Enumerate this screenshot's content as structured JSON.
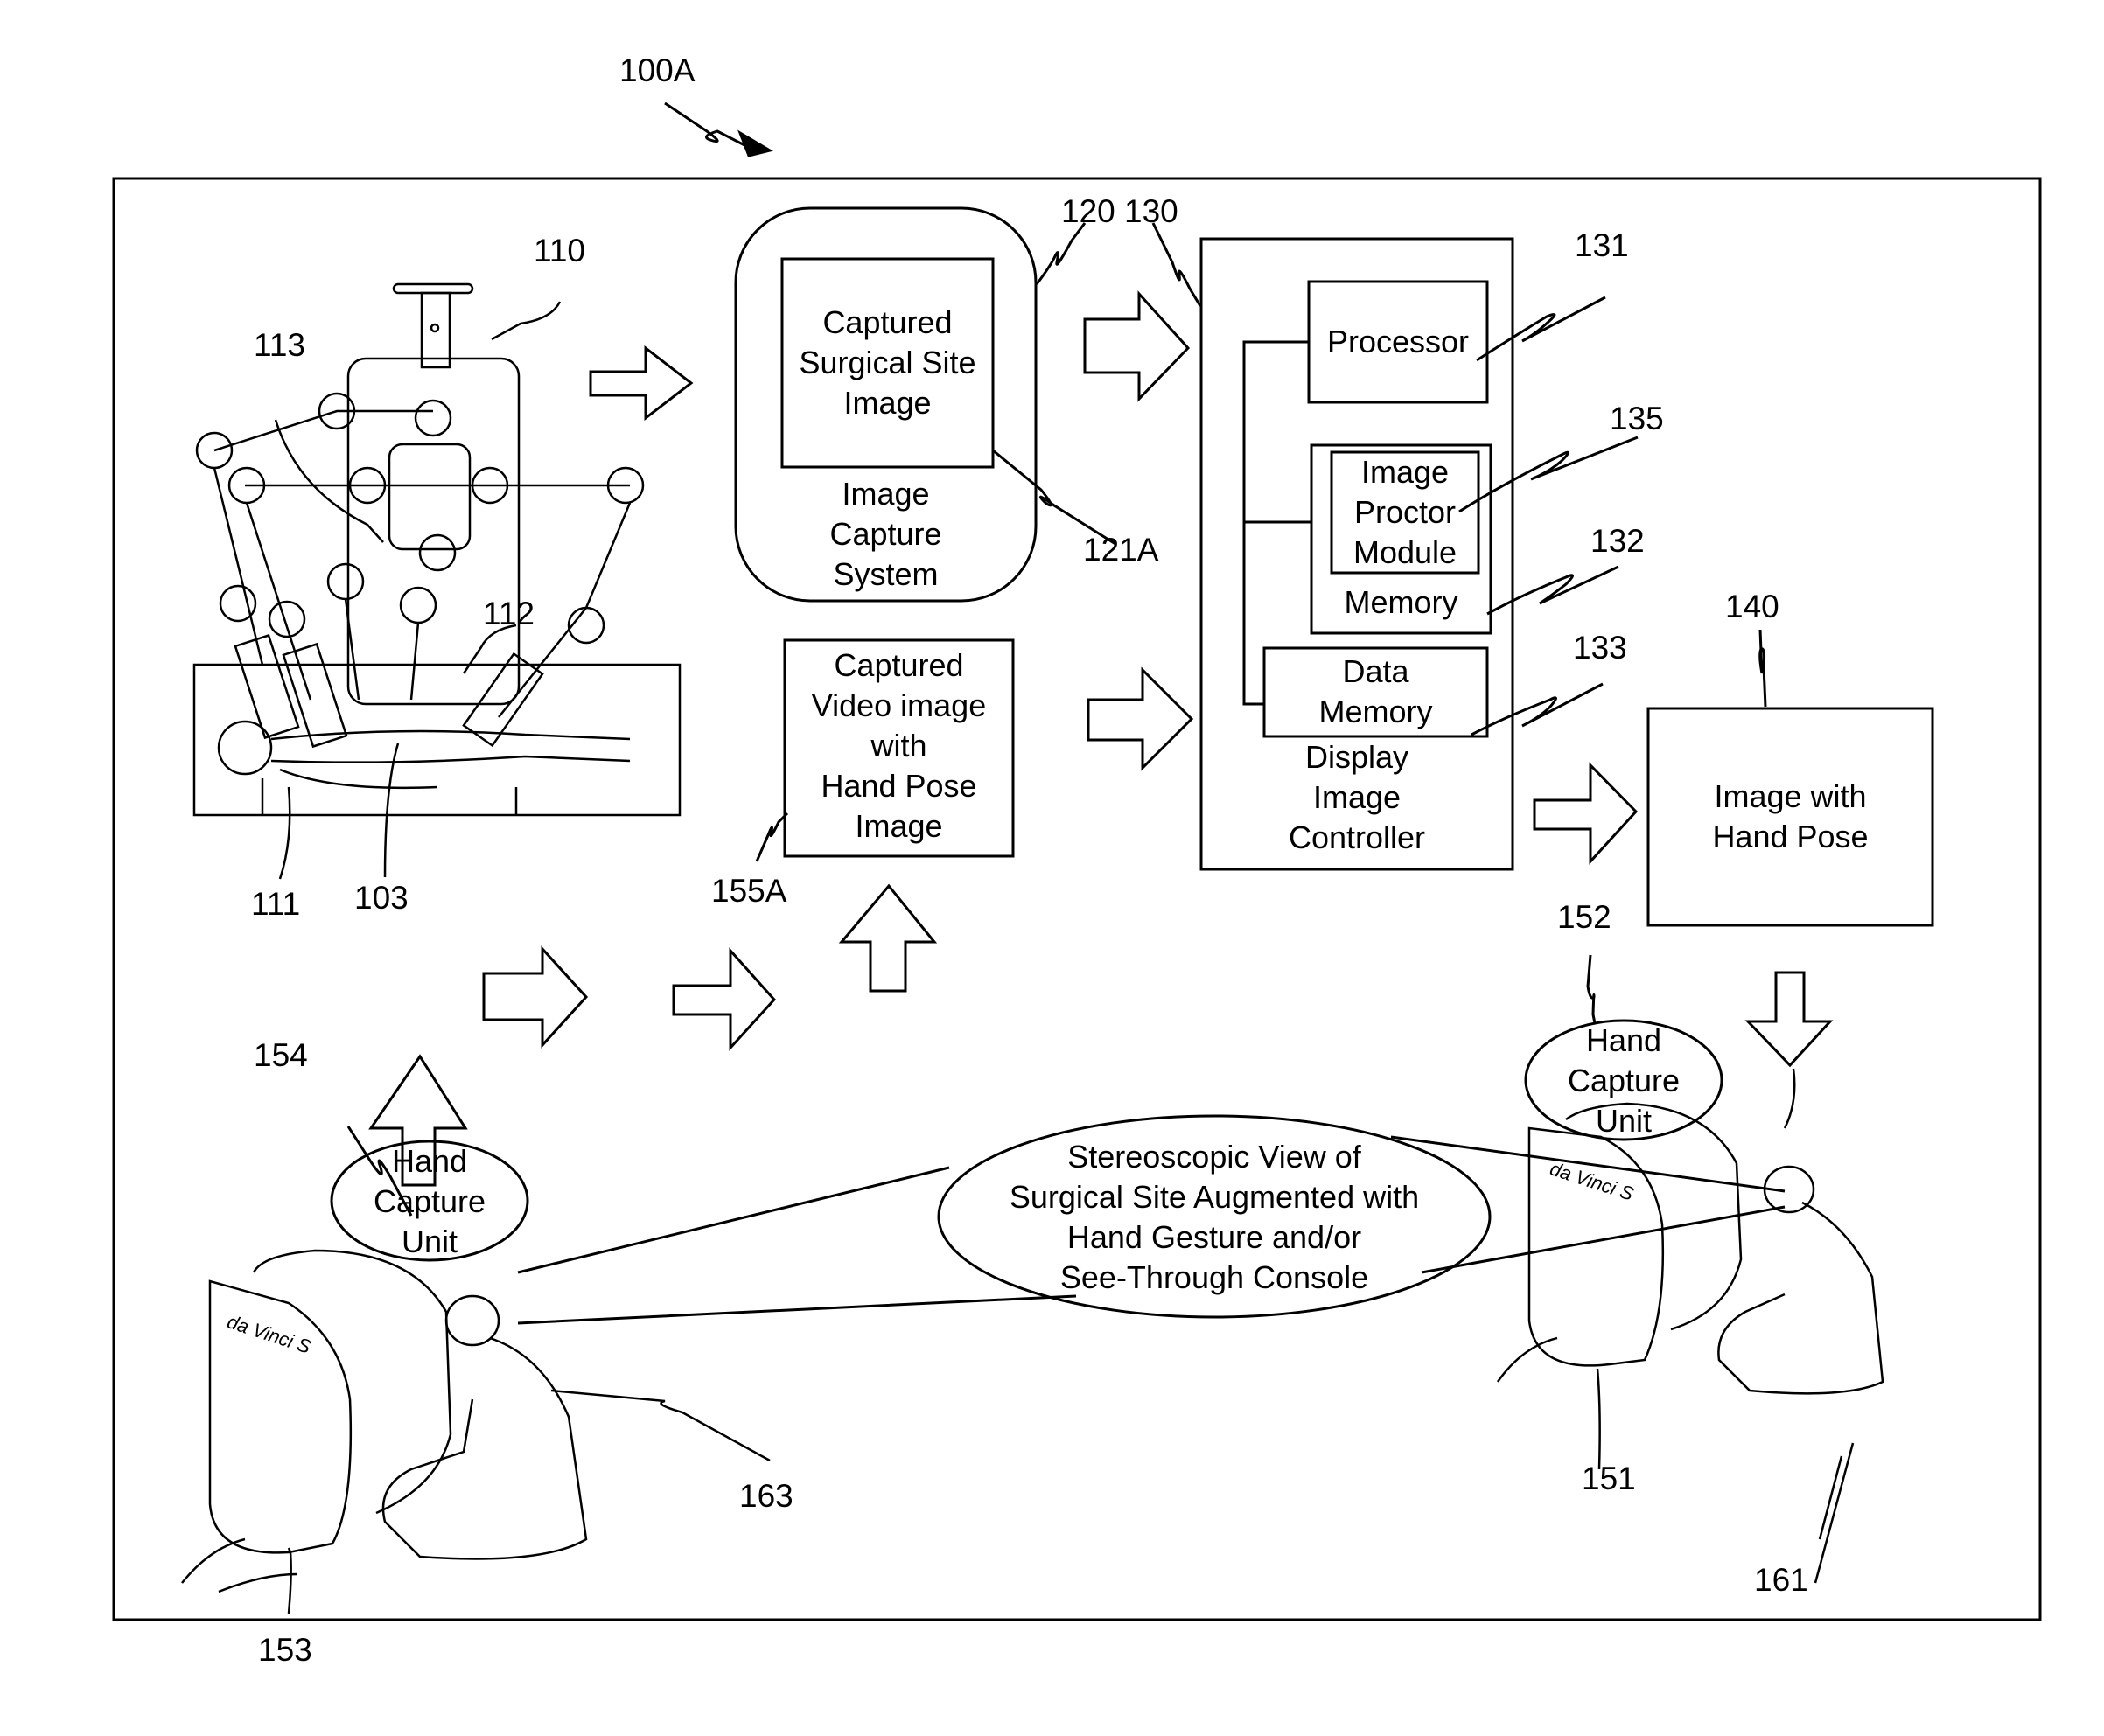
{
  "figure": {
    "figure_label": "100A",
    "reference_numerals": {
      "robot": "110",
      "patient": "111",
      "instrument": "112",
      "arm": "113",
      "table": "103",
      "image_capture_system": "120",
      "captured_image": "121A",
      "display_controller": "130",
      "processor": "131",
      "memory": "132",
      "data_memory": "133",
      "proctor_module": "135",
      "display_image": "140",
      "console_right": "151",
      "hand_capture_right": "152",
      "console_left": "153",
      "hand_capture_left": "154",
      "captured_video": "155A",
      "surgeon_right": "161",
      "surgeon_left": "163"
    },
    "blocks": {
      "image_capture_system": [
        "Image",
        "Capture",
        "System"
      ],
      "captured_surgical_site": [
        "Captured",
        "Surgical Site",
        "Image"
      ],
      "captured_video": [
        "Captured",
        "Video image",
        "with",
        "Hand Pose",
        "Image"
      ],
      "processor": [
        "Processor"
      ],
      "proctor_module": [
        "Image",
        "Proctor",
        "Module"
      ],
      "memory": [
        "Memory"
      ],
      "data_memory": [
        "Data",
        "Memory"
      ],
      "display_controller": [
        "Display",
        "Image",
        "Controller"
      ],
      "image_with_hand_pose": [
        "Image with",
        "Hand Pose"
      ],
      "hand_capture_left": [
        "Hand",
        "Capture",
        "Unit"
      ],
      "hand_capture_right": [
        "Hand",
        "Capture",
        "Unit"
      ],
      "stereoscopic_view": [
        "Stereoscopic View of",
        "Surgical Site Augmented with",
        "Hand Gesture and/or",
        "See-Through Console"
      ]
    },
    "console_brand": "da Vinci S"
  }
}
